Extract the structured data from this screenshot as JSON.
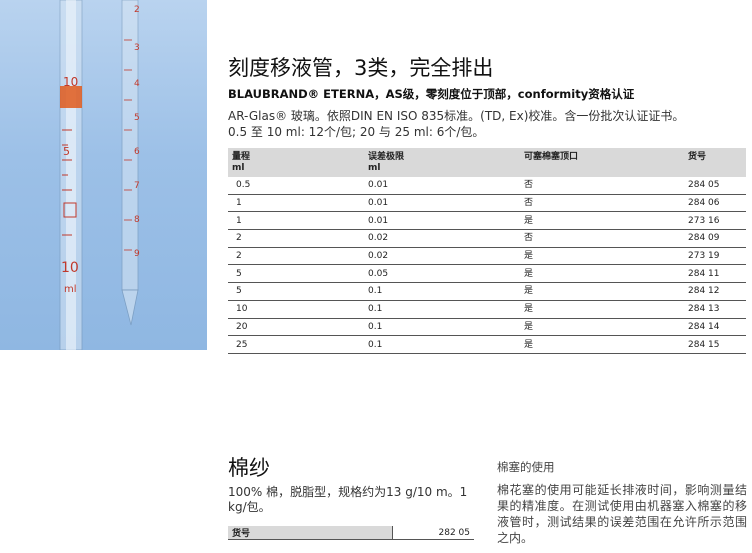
{
  "product_photo": {
    "marks_left": [
      "10",
      "5",
      "10",
      "ml"
    ],
    "marks_right": [
      "2",
      "3",
      "4",
      "5",
      "6",
      "7",
      "8",
      "9"
    ]
  },
  "section": {
    "title": "刻度移液管，3类，完全排出",
    "subtitle": "BLAUBRAND® ETERNA，AS级，零刻度位于顶部，conformity资格认证",
    "desc_line1": "AR-Glas® 玻璃。依照DIN EN ISO 835标准。(TD, Ex)校准。含一份批次认证证书。",
    "desc_line2": "0.5 至 10 ml: 12个/包; 20 与 25 ml: 6个/包。"
  },
  "table": {
    "headers": [
      "量程\nml",
      "误差极限\nml",
      "可塞棉塞顶口",
      "货号"
    ],
    "rows": [
      [
        "0.5",
        "0.01",
        "否",
        "284 05"
      ],
      [
        "1",
        "0.01",
        "否",
        "284 06"
      ],
      [
        "1",
        "0.01",
        "是",
        "273 16"
      ],
      [
        "2",
        "0.02",
        "否",
        "284 09"
      ],
      [
        "2",
        "0.02",
        "是",
        "273 19"
      ],
      [
        "5",
        "0.05",
        "是",
        "284 11"
      ],
      [
        "5",
        "0.1",
        "是",
        "284 12"
      ],
      [
        "10",
        "0.1",
        "是",
        "284 13"
      ],
      [
        "20",
        "0.1",
        "是",
        "284 14"
      ],
      [
        "25",
        "0.1",
        "是",
        "284 15"
      ]
    ]
  },
  "cotton": {
    "title": "棉纱",
    "desc": "100% 棉，脱脂型，规格约为13 g/10 m。1 kg/包。",
    "label": "货号",
    "value": "282 05"
  },
  "note": {
    "title": "棉塞的使用",
    "body": "棉花塞的使用可能延长排液时间，影响测量结果的精准度。在测试使用由机器塞入棉塞的移液管时，测试结果的误差范围在允许所示范围之内。"
  },
  "colors": {
    "photo_bg": "#9cc0e7",
    "table_header_bg": "#d9d9d9",
    "pipette_band": "#e05a1c",
    "marking": "#c0392b"
  }
}
